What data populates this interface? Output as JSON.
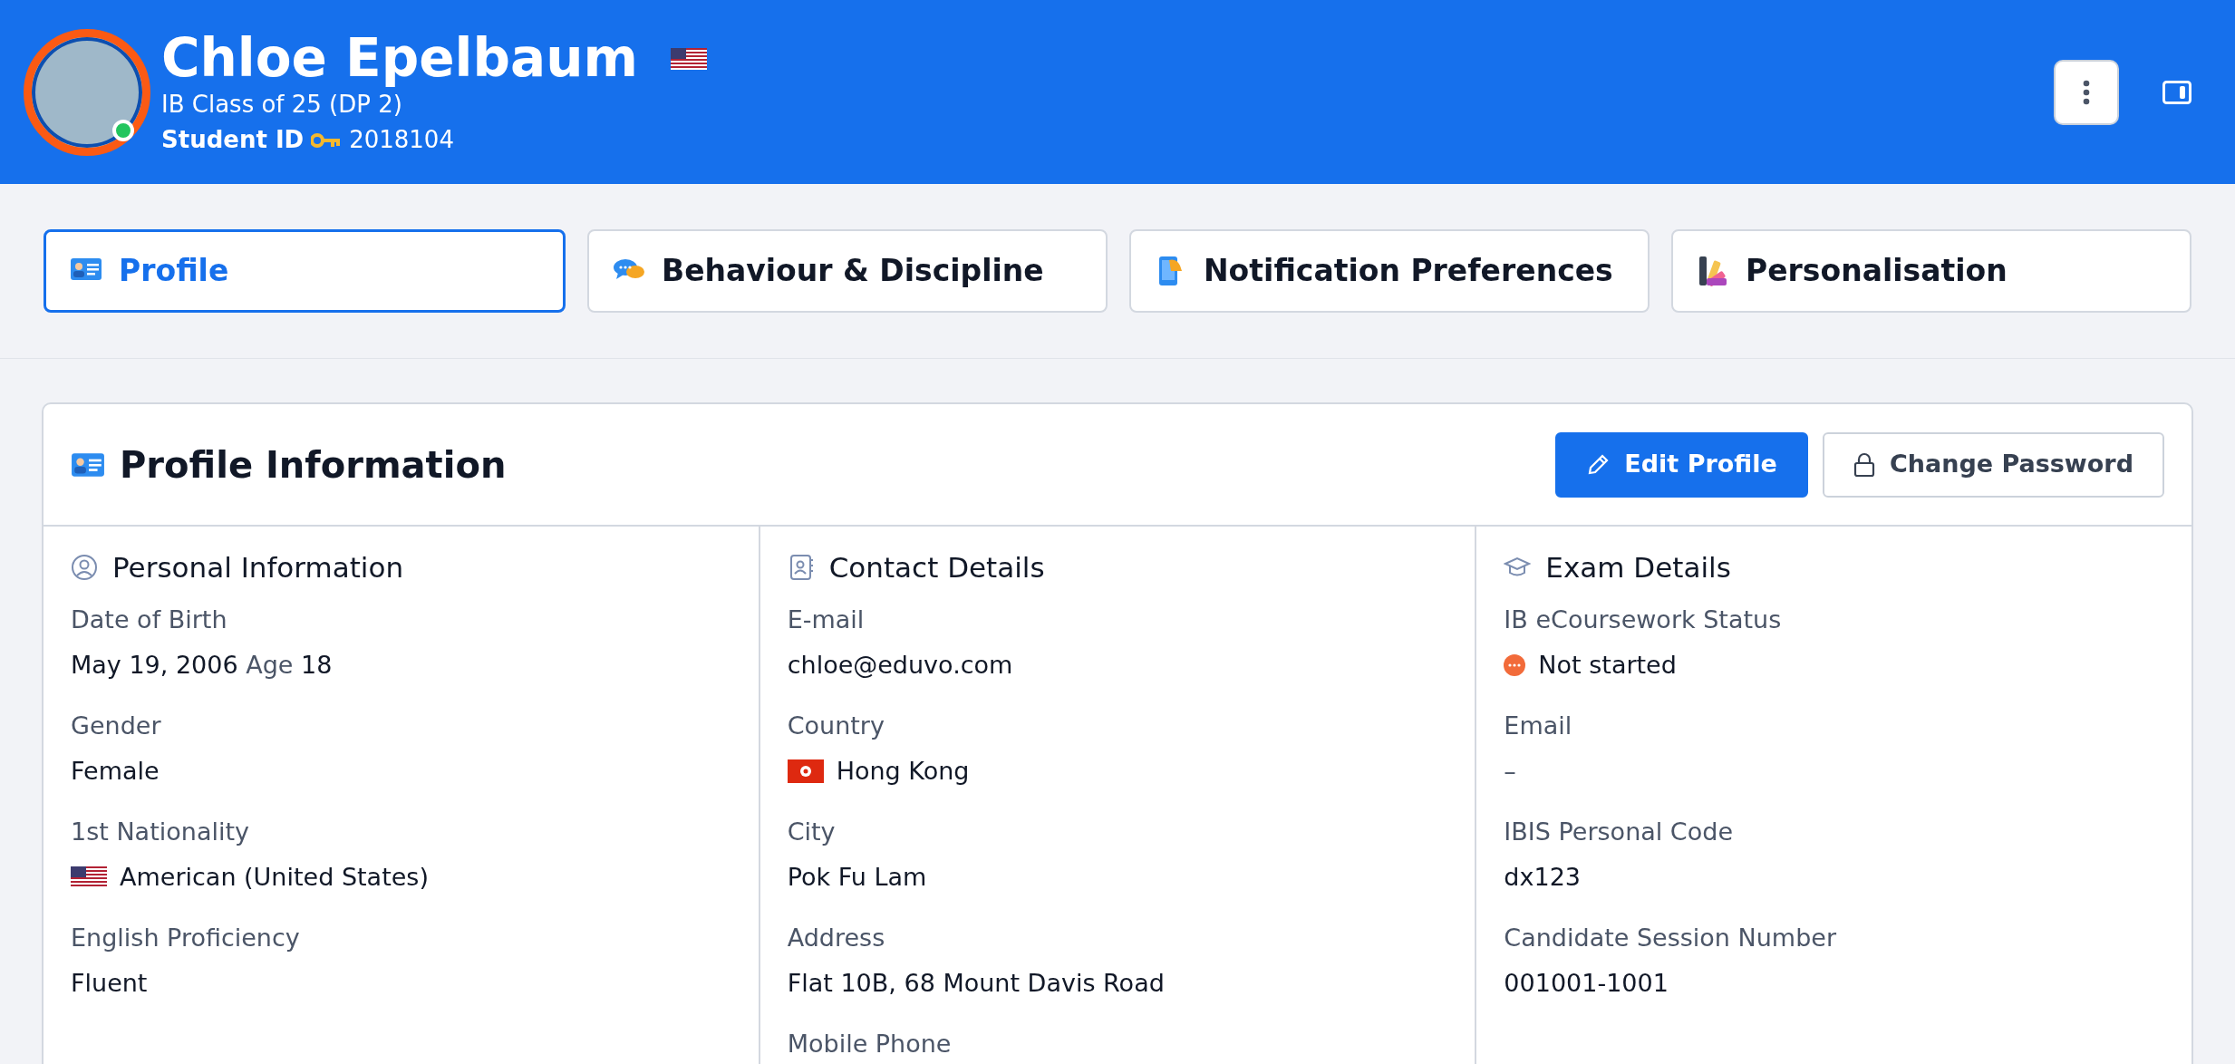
{
  "header": {
    "name": "Chloe Epelbaum",
    "online": true,
    "class": "IB Class of 25 (DP 2)",
    "id_label": "Student ID",
    "id_value": "2018104"
  },
  "tabs": [
    {
      "label": "Profile",
      "selected": true
    },
    {
      "label": "Behaviour & Discipline",
      "selected": false
    },
    {
      "label": "Notification Preferences",
      "selected": false
    },
    {
      "label": "Personalisation",
      "selected": false
    }
  ],
  "card": {
    "title": "Profile Information",
    "buttons": [
      {
        "label": "Edit Profile",
        "kind": "primary"
      },
      {
        "label": "Change Password",
        "kind": "outline"
      }
    ],
    "sections": [
      {
        "title": "Personal Information",
        "fields": [
          {
            "label": "Date of Birth",
            "kind": "dob",
            "value": "May 19, 2006",
            "age_label": "Age",
            "age": "18"
          },
          {
            "label": "Gender",
            "kind": "text",
            "value": "Female"
          },
          {
            "label": "1st Nationality",
            "kind": "us-flag",
            "value": "American (United States)"
          },
          {
            "label": "English Proficiency",
            "kind": "text",
            "value": "Fluent"
          }
        ]
      },
      {
        "title": "Contact Details",
        "fields": [
          {
            "label": "E-mail",
            "kind": "text",
            "value": "chloe@eduvo.com"
          },
          {
            "label": "Country",
            "kind": "hk-flag",
            "value": "Hong Kong"
          },
          {
            "label": "City",
            "kind": "text",
            "value": "Pok Fu Lam"
          },
          {
            "label": "Address",
            "kind": "text",
            "value": "Flat 10B, 68 Mount Davis Road"
          },
          {
            "label": "Mobile Phone",
            "kind": "label-only"
          }
        ]
      },
      {
        "title": "Exam Details",
        "fields": [
          {
            "label": "IB eCoursework Status",
            "kind": "status",
            "value": "Not started",
            "color": "#f26b3a"
          },
          {
            "label": "Email",
            "kind": "empty",
            "value": "–"
          },
          {
            "label": "IBIS Personal Code",
            "kind": "text",
            "value": "dx123"
          },
          {
            "label": "Candidate Session Number",
            "kind": "text",
            "value": "001001-1001"
          }
        ]
      }
    ]
  }
}
